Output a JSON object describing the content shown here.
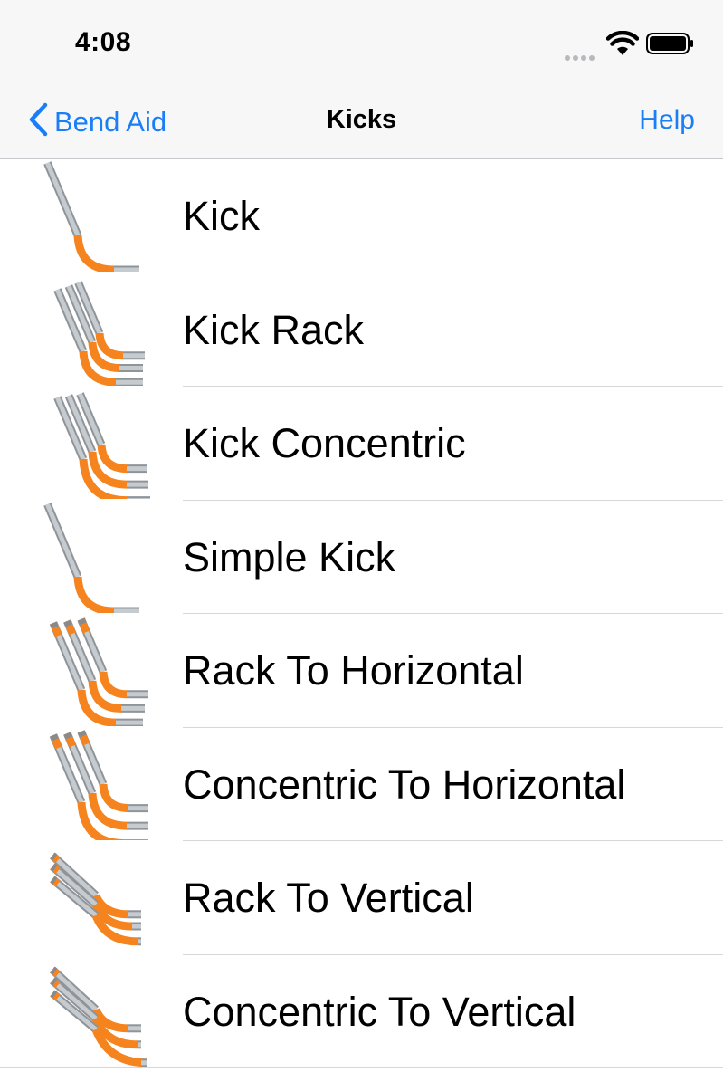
{
  "status_bar": {
    "time": "4:08",
    "icons": [
      "signal-dots-icon",
      "wifi-icon",
      "battery-icon"
    ]
  },
  "nav": {
    "back_label": "Bend Aid",
    "title": "Kicks",
    "help_label": "Help"
  },
  "colors": {
    "accent": "#1a7ef7",
    "conduit_bend": "#f5841f",
    "conduit_pipe": "#c6cbd0"
  },
  "items": [
    {
      "label": "Kick",
      "icon": "kick-icon"
    },
    {
      "label": "Kick Rack",
      "icon": "kick-rack-icon"
    },
    {
      "label": "Kick Concentric",
      "icon": "kick-concentric-icon"
    },
    {
      "label": "Simple Kick",
      "icon": "simple-kick-icon"
    },
    {
      "label": "Rack To Horizontal",
      "icon": "rack-to-horizontal-icon"
    },
    {
      "label": "Concentric To Horizontal",
      "icon": "concentric-to-horizontal-icon"
    },
    {
      "label": "Rack To Vertical",
      "icon": "rack-to-vertical-icon"
    },
    {
      "label": "Concentric To Vertical",
      "icon": "concentric-to-vertical-icon"
    }
  ]
}
